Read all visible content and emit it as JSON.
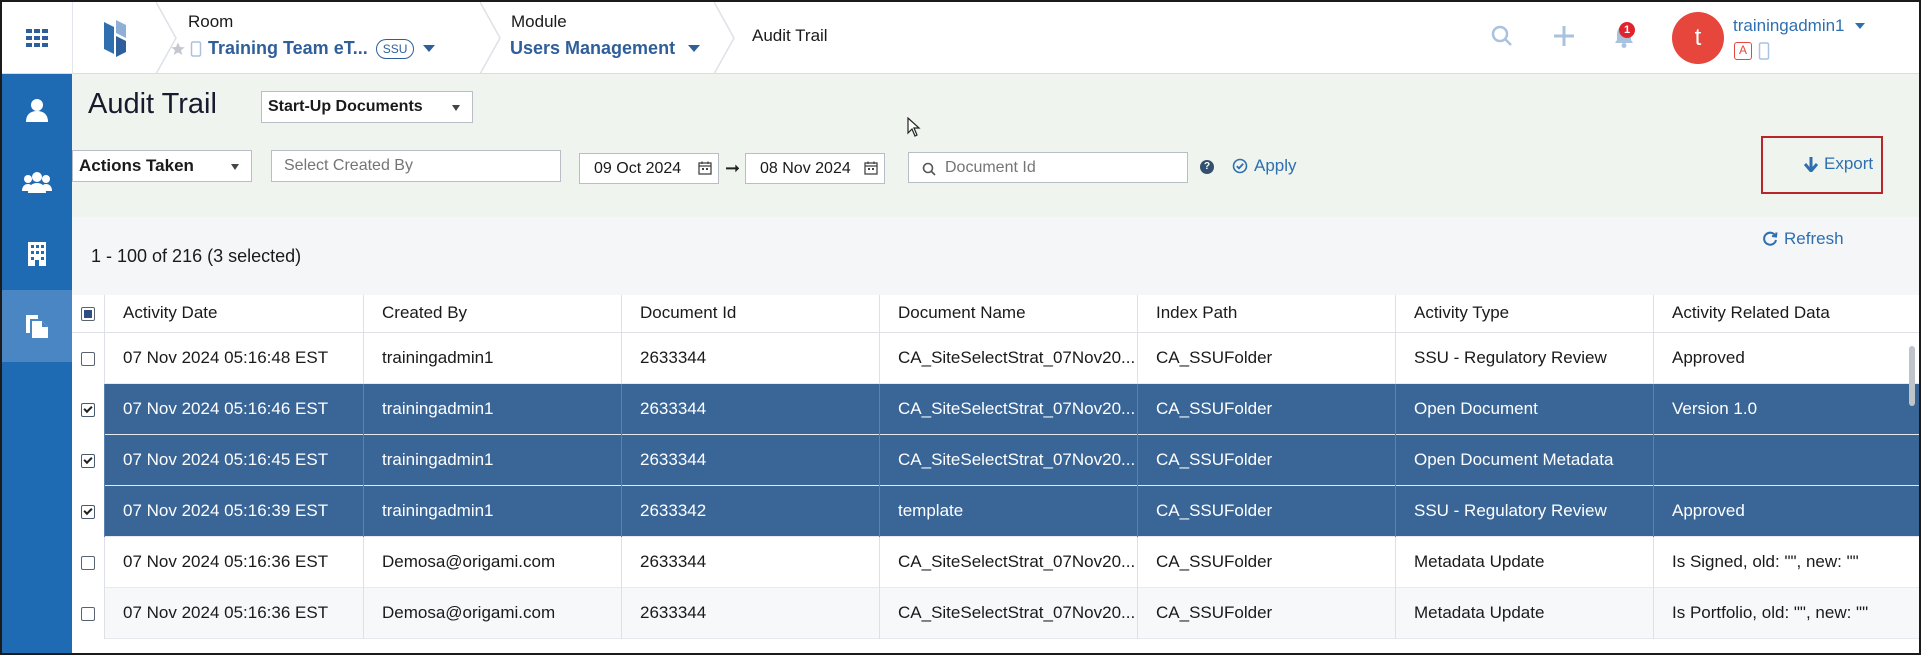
{
  "topbar": {
    "room_label": "Room",
    "room_value": "Training Team eT...",
    "room_badge": "SSU",
    "module_label": "Module",
    "module_value": "Users Management",
    "page_crumb": "Audit Trail",
    "notification_count": "1",
    "user_initial": "t",
    "username": "trainingadmin1",
    "role_badge": "A"
  },
  "sidebar": {
    "items": [
      {
        "icon": "user-icon"
      },
      {
        "icon": "users-group-icon"
      },
      {
        "icon": "building-icon"
      },
      {
        "icon": "documents-icon",
        "active": true
      }
    ]
  },
  "header": {
    "title": "Audit Trail",
    "category_select": "Start-Up Documents",
    "actions_select": "Actions Taken",
    "created_by_placeholder": "Select Created By",
    "date_from": "09 Oct 2024",
    "date_to": "08 Nov 2024",
    "document_id_placeholder": "Document Id",
    "apply_label": "Apply",
    "export_label": "Export"
  },
  "summary": {
    "text": "1 - 100 of 216 (3 selected)",
    "refresh_label": "Refresh"
  },
  "table": {
    "columns": [
      "Activity Date",
      "Created By",
      "Document Id",
      "Document Name",
      "Index Path",
      "Activity Type",
      "Activity Related Data"
    ],
    "rows": [
      {
        "selected": false,
        "cells": [
          "07 Nov 2024 05:16:48 EST",
          "trainingadmin1",
          "2633344",
          "CA_SiteSelectStrat_07Nov20...",
          "CA_SSUFolder",
          "SSU - Regulatory Review",
          "Approved"
        ]
      },
      {
        "selected": true,
        "cells": [
          "07 Nov 2024 05:16:46 EST",
          "trainingadmin1",
          "2633344",
          "CA_SiteSelectStrat_07Nov20...",
          "CA_SSUFolder",
          "Open Document",
          "Version 1.0"
        ]
      },
      {
        "selected": true,
        "cells": [
          "07 Nov 2024 05:16:45 EST",
          "trainingadmin1",
          "2633344",
          "CA_SiteSelectStrat_07Nov20...",
          "CA_SSUFolder",
          "Open Document Metadata",
          ""
        ]
      },
      {
        "selected": true,
        "cells": [
          "07 Nov 2024 05:16:39 EST",
          "trainingadmin1",
          "2633342",
          "template",
          "CA_SSUFolder",
          "SSU - Regulatory Review",
          "Approved"
        ]
      },
      {
        "selected": false,
        "cells": [
          "07 Nov 2024 05:16:36 EST",
          "Demosa@origami.com",
          "2633344",
          "CA_SiteSelectStrat_07Nov20...",
          "CA_SSUFolder",
          "Metadata Update",
          "Is Signed, old: \"\", new: \"\""
        ]
      },
      {
        "selected": false,
        "cells": [
          "07 Nov 2024 05:16:36 EST",
          "Demosa@origami.com",
          "2633344",
          "CA_SiteSelectStrat_07Nov20...",
          "CA_SSUFolder",
          "Metadata Update",
          "Is Portfolio, old: \"\", new: \"\""
        ]
      }
    ]
  },
  "colors": {
    "sidebar": "#1f6bb3",
    "selected_row": "#396597",
    "accent": "#2f6fb0",
    "export_highlight": "#b8262b"
  }
}
